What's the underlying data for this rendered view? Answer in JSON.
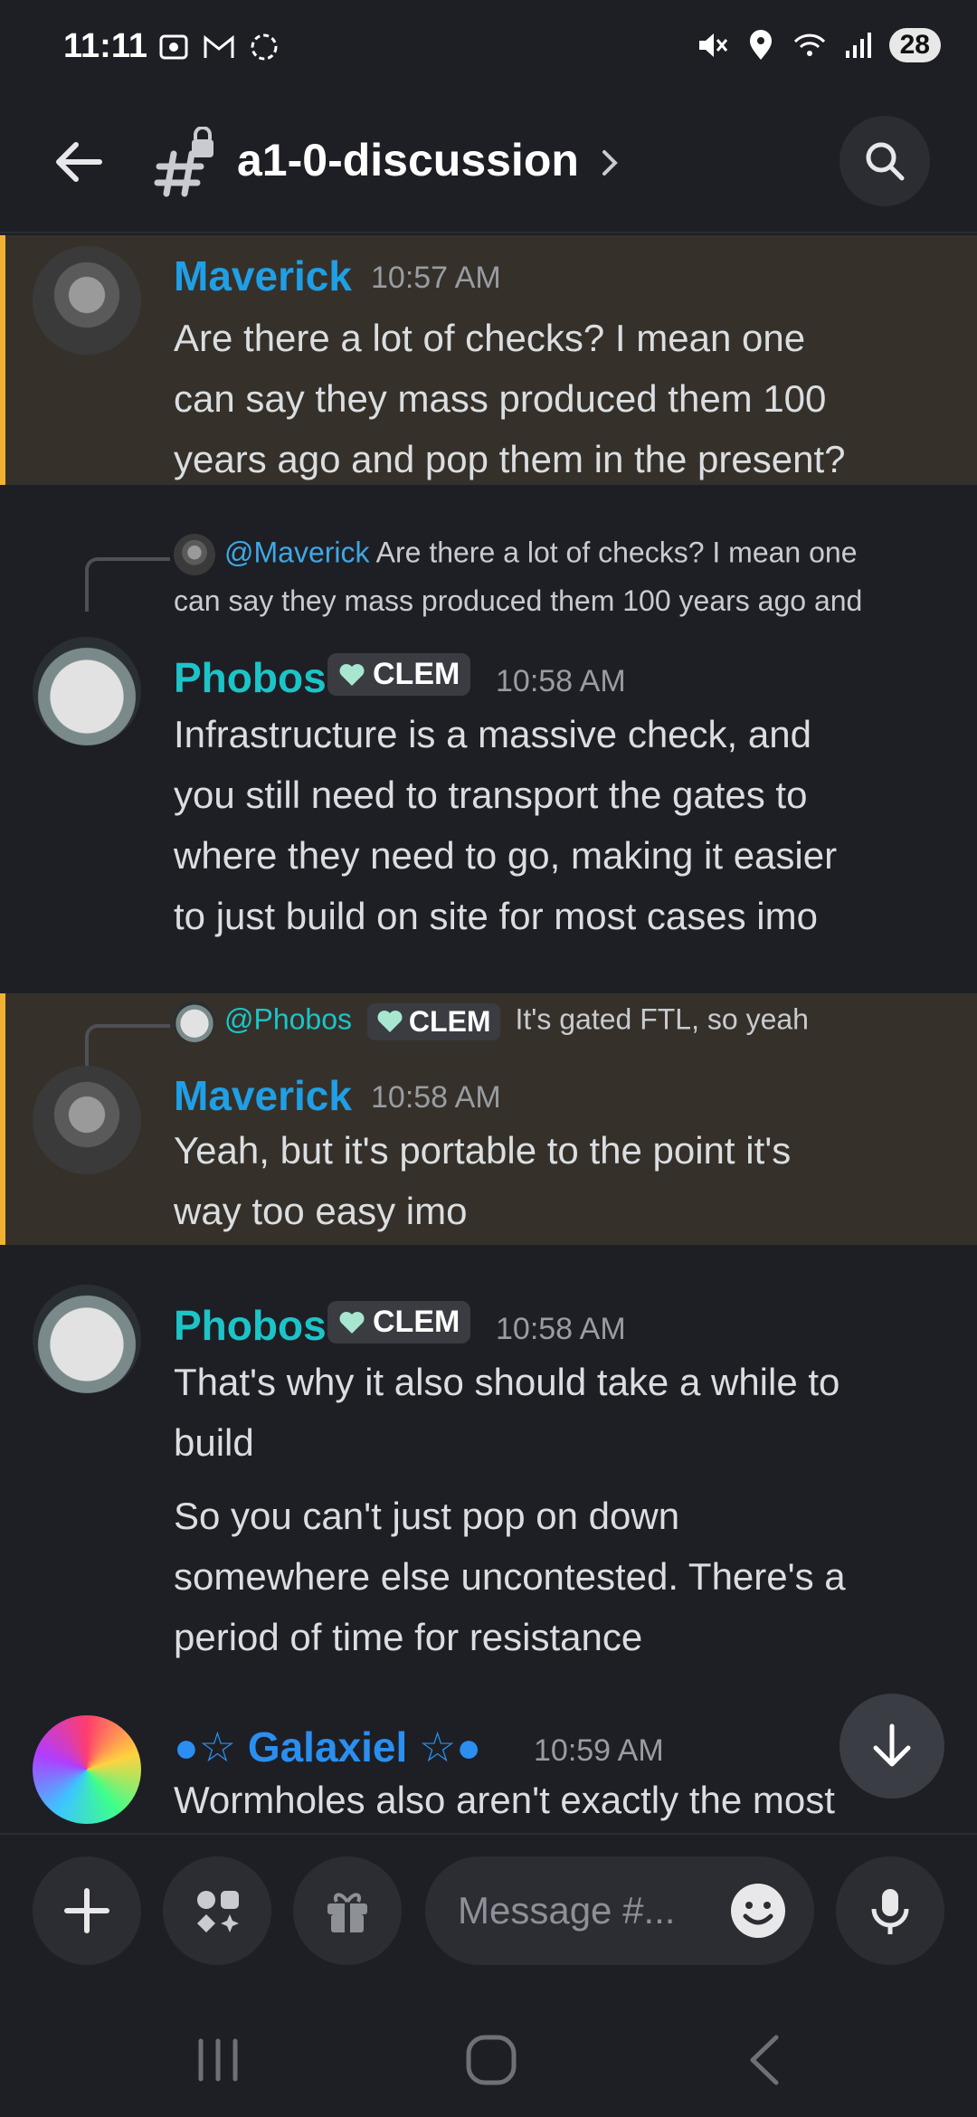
{
  "status": {
    "time": "11:11",
    "battery": "28"
  },
  "header": {
    "channel": "a1-0-discussion"
  },
  "messages": [
    {
      "author": "Maverick",
      "time": "10:57 AM",
      "lines": [
        "Are there a lot of checks? I mean one",
        "can say they mass produced them 100",
        "years ago and pop them in the present?"
      ]
    },
    {
      "reply_to": "@Maverick",
      "reply_text_1": "Are there a lot of checks? I mean one",
      "reply_text_2": "can say they mass produced them 100 years ago and",
      "author": "Phobos",
      "tag": "CLEM",
      "time": "10:58 AM",
      "lines": [
        "Infrastructure is a massive check, and",
        "you still need to transport the gates to",
        "where they need to go, making it easier",
        "to just build on site for most cases imo"
      ]
    },
    {
      "reply_to": "@Phobos",
      "reply_tag": "CLEM",
      "reply_text": "It's gated FTL, so yeah",
      "author": "Maverick",
      "time": "10:58 AM",
      "lines": [
        "Yeah, but it's portable to the point it's",
        "way too easy imo"
      ]
    },
    {
      "author": "Phobos",
      "tag": "CLEM",
      "time": "10:58 AM",
      "lines": [
        "That's why it also should take a while to",
        "build"
      ],
      "lines2": [
        "So you can't just pop on down",
        "somewhere else uncontested. There's a",
        "period of time for resistance"
      ]
    },
    {
      "author": "Galaxiel",
      "time": "10:59 AM",
      "lines": [
        "Wormholes also aren't exactly the most"
      ]
    }
  ],
  "composer": {
    "placeholder": "Message #..."
  },
  "icons": {
    "back": "arrow-left-icon",
    "channel": "hashtag-lock-icon",
    "search": "search-icon",
    "jump": "arrow-down-icon",
    "add": "plus-icon",
    "apps": "apps-icon",
    "gift": "gift-icon",
    "emoji": "emoji-icon",
    "mic": "microphone-icon"
  },
  "colors": {
    "highlight_bar": "#f0b232",
    "maverick": "#1f9fe6",
    "phobos": "#1cc4c8",
    "galaxiel": "#2a8ff0"
  }
}
